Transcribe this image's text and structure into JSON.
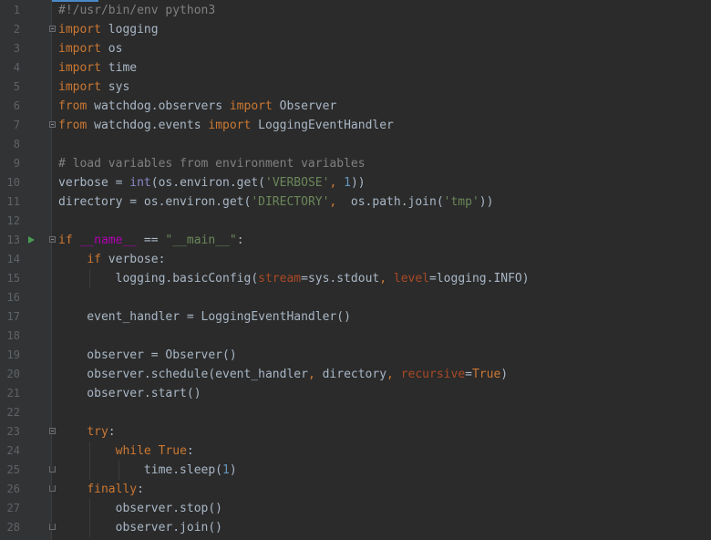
{
  "editor": {
    "language": "python",
    "accent_color": "#4a88c7",
    "run_marker_line": 13,
    "lines": [
      {
        "n": "1",
        "text": "#!/usr/bin/env python3"
      },
      {
        "n": "2",
        "text": "import logging"
      },
      {
        "n": "3",
        "text": "import os"
      },
      {
        "n": "4",
        "text": "import time"
      },
      {
        "n": "5",
        "text": "import sys"
      },
      {
        "n": "6",
        "text": "from watchdog.observers import Observer"
      },
      {
        "n": "7",
        "text": "from watchdog.events import LoggingEventHandler"
      },
      {
        "n": "8",
        "text": ""
      },
      {
        "n": "9",
        "text": "# load variables from environment variables"
      },
      {
        "n": "10",
        "text": "verbose = int(os.environ.get('VERBOSE', 1))"
      },
      {
        "n": "11",
        "text": "directory = os.environ.get('DIRECTORY',  os.path.join('tmp'))"
      },
      {
        "n": "12",
        "text": ""
      },
      {
        "n": "13",
        "text": "if __name__ == \"__main__\":"
      },
      {
        "n": "14",
        "text": "    if verbose:"
      },
      {
        "n": "15",
        "text": "        logging.basicConfig(stream=sys.stdout, level=logging.INFO)"
      },
      {
        "n": "16",
        "text": ""
      },
      {
        "n": "17",
        "text": "    event_handler = LoggingEventHandler()"
      },
      {
        "n": "18",
        "text": ""
      },
      {
        "n": "19",
        "text": "    observer = Observer()"
      },
      {
        "n": "20",
        "text": "    observer.schedule(event_handler, directory, recursive=True)"
      },
      {
        "n": "21",
        "text": "    observer.start()"
      },
      {
        "n": "22",
        "text": ""
      },
      {
        "n": "23",
        "text": "    try:"
      },
      {
        "n": "24",
        "text": "        while True:"
      },
      {
        "n": "25",
        "text": "            time.sleep(1)"
      },
      {
        "n": "26",
        "text": "    finally:"
      },
      {
        "n": "27",
        "text": "        observer.stop()"
      },
      {
        "n": "28",
        "text": "        observer.join()"
      }
    ]
  }
}
